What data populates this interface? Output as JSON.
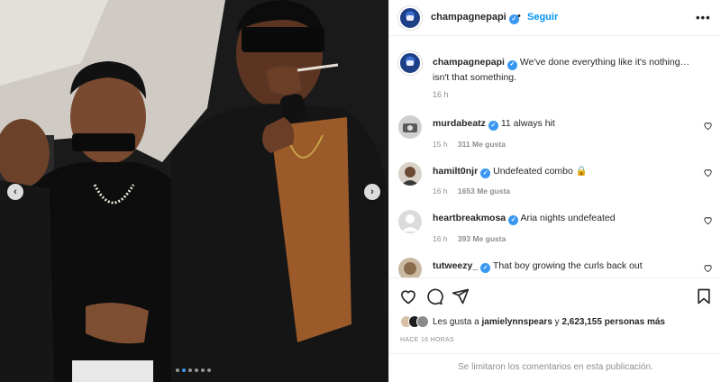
{
  "post": {
    "carousel": {
      "count": 6,
      "active_index": 1
    },
    "header": {
      "username": "champagnepapi",
      "separator": "•",
      "follow_label": "Seguir",
      "more_label": "•••"
    },
    "caption": {
      "username": "champagnepapi",
      "text": "We've done everything like it's nothing…isn't that something.",
      "time": "16 h"
    },
    "comments": [
      {
        "username": "murdabeatz",
        "text": "11 always hit",
        "time": "15 h",
        "likes": "311 Me gusta",
        "verified": true
      },
      {
        "username": "hamilt0njr",
        "text": "Undefeated combo 🔒",
        "time": "16 h",
        "likes": "1653 Me gusta",
        "verified": true
      },
      {
        "username": "heartbreakmosa",
        "text": "Aria nights undefeated",
        "time": "16 h",
        "likes": "393 Me gusta",
        "verified": true
      },
      {
        "username": "tutweezy_",
        "text": "That boy growing the curls back out",
        "time": "",
        "likes": "",
        "verified": true
      }
    ],
    "likes": {
      "prefix": "Les gusta a",
      "user": "jamielynnspears",
      "conj": "y",
      "count_text": "2,623,155 personas más"
    },
    "posted_ago": "HACE 16 HORAS",
    "comments_limited": "Se limitaron los comentarios en esta publicación.",
    "colors": {
      "accent": "#0095f6",
      "verified": "#3897f0",
      "muted": "#8e8e8e"
    }
  }
}
